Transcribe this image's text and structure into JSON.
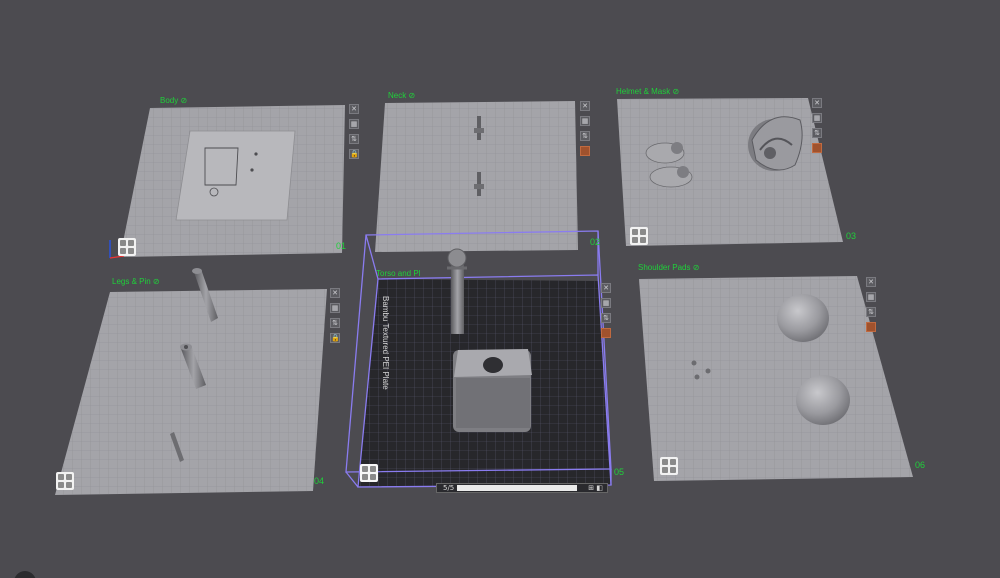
{
  "plates": [
    {
      "id": "plate-01",
      "label": "Body ⊘",
      "number": "01",
      "selected": false
    },
    {
      "id": "plate-02",
      "label": "Neck ⊘",
      "number": "02",
      "selected": false
    },
    {
      "id": "plate-03",
      "label": "Helmet & Mask ⊘",
      "number": "03",
      "selected": false
    },
    {
      "id": "plate-04",
      "label": "Legs & Pin ⊘",
      "number": "04",
      "selected": false
    },
    {
      "id": "plate-05",
      "label": "Torso and Pl",
      "number": "05",
      "selected": true
    },
    {
      "id": "plate-06",
      "label": "Shoulder Pads ⊘",
      "number": "06",
      "selected": false
    }
  ],
  "plate_toolbar_icons": [
    "close-icon",
    "arrange-icon",
    "orient-icon",
    "lock-icon",
    "settings-icon"
  ],
  "toolbar_glyphs": {
    "close": "✕",
    "arrange": "▦",
    "orient": "⇅",
    "lock": "🔒"
  },
  "build_plate_text": "Bambu Textured PEI Plate",
  "bottom_bar": {
    "left": "5/5",
    "right": "⊞ ◧"
  },
  "colors": {
    "background": "#4c4b50",
    "plate": "#a6a6ab",
    "grid": "#8b8b90",
    "label": "#1fd13a",
    "selection": "#8a7cf0",
    "model": "#8f8f94",
    "dark_plate": "#27272b"
  }
}
